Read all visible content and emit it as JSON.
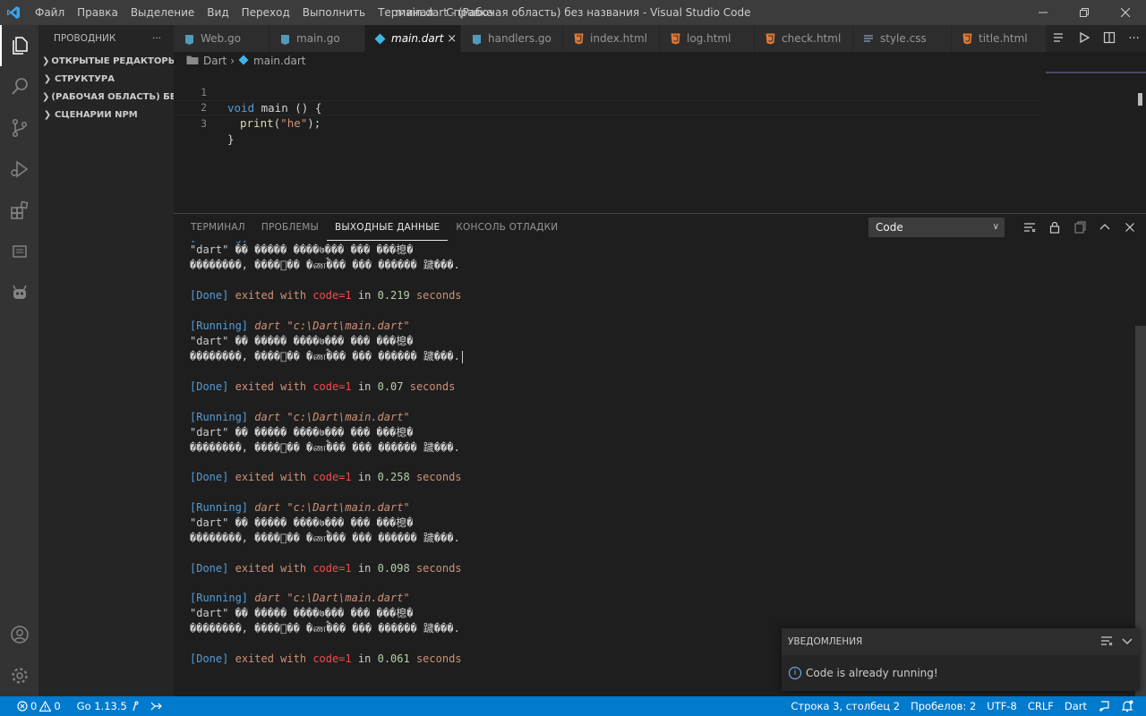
{
  "window": {
    "title": "main.dart - (Рабочая область) без названия - Visual Studio Code",
    "menu": [
      "Файл",
      "Правка",
      "Выделение",
      "Вид",
      "Переход",
      "Выполнить",
      "Терминал",
      "Справка"
    ]
  },
  "sidebar": {
    "title": "ПРОВОДНИК",
    "more": "···",
    "sections": [
      "ОТКРЫТЫЕ РЕДАКТОРЫ",
      "СТРУКТУРА",
      "(РАБОЧАЯ ОБЛАСТЬ) БЕЗ ...",
      "СЦЕНАРИИ NPM"
    ]
  },
  "tabs": [
    {
      "label": "Web.go",
      "icon": "go-file-icon"
    },
    {
      "label": "main.go",
      "icon": "go-file-icon"
    },
    {
      "label": "main.dart",
      "icon": "dart-file-icon",
      "active": true
    },
    {
      "label": "handlers.go",
      "icon": "go-file-icon"
    },
    {
      "label": "index.html",
      "icon": "html-file-icon"
    },
    {
      "label": "log.html",
      "icon": "html-file-icon"
    },
    {
      "label": "check.html",
      "icon": "html-file-icon"
    },
    {
      "label": "style.css",
      "icon": "css-file-icon"
    },
    {
      "label": "title.html",
      "icon": "html-file-icon"
    }
  ],
  "breadcrumb": {
    "folder": "Dart",
    "file": "main.dart"
  },
  "editor": {
    "lines": [
      {
        "num": "1",
        "kw": "void",
        "rest": " main () {"
      },
      {
        "num": "2",
        "fn": "print",
        "str": "\"he\"",
        "end": ");"
      },
      {
        "num": "3",
        "text": "}"
      }
    ]
  },
  "panel": {
    "tabs": [
      "ТЕРМИНАЛ",
      "ПРОБЛЕМЫ",
      "ВЫХОДНЫЕ ДАННЫЕ",
      "КОНСОЛЬ ОТЛАДКИ"
    ],
    "active_tab": "ВЫХОДНЫЕ ДАННЫЕ",
    "channel": "Code",
    "output": {
      "garbled_1": "\"dart\" �� ����� ����७��� ��� ���㮩�",
      "garbled_2": "��������, ����ᮬ�� �ணࠬ��� ��� ������ 䠩���.",
      "running_tag": "[Running]",
      "running_cmd": "dart \"c:\\Dart\\main.dart\"",
      "done_tag": "[Done]",
      "exited_with": "exited with",
      "code": "code=1",
      "in": "in",
      "seconds": "seconds",
      "runs": [
        {
          "time": "0.219"
        },
        {
          "time": "0.07"
        },
        {
          "time": "0.258"
        },
        {
          "time": "0.098"
        },
        {
          "time": "0.061"
        }
      ]
    }
  },
  "notification": {
    "title": "УВЕДОМЛЕНИЯ",
    "message": "Code is already running!"
  },
  "statusbar": {
    "errors": "0",
    "warnings": "0",
    "go_version": "Go 1.13.5",
    "position": "Строка 3, столбец 2",
    "spaces": "Пробелов: 2",
    "encoding": "UTF-8",
    "eol": "CRLF",
    "language": "Dart"
  },
  "colors": {
    "accent": "#007acc",
    "titlebar": "#3c3c3c",
    "activitybar": "#333333",
    "sidebar": "#252526",
    "editor": "#1e1e1e"
  }
}
